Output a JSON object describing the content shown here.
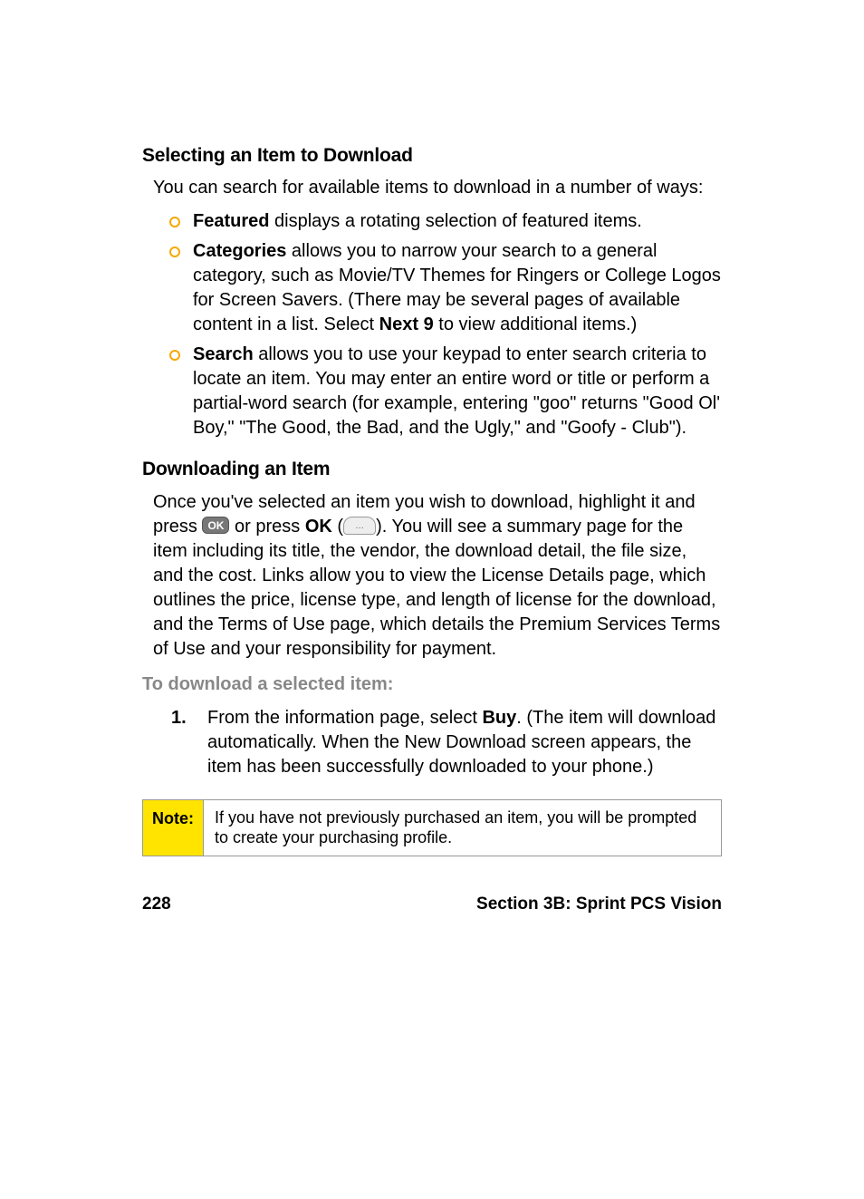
{
  "sections": {
    "selecting": {
      "heading": "Selecting an Item to Download",
      "intro": "You can search for available items to download in a number of ways:",
      "items": [
        {
          "term": "Featured",
          "desc": " displays a rotating selection of featured items."
        },
        {
          "term": "Categories",
          "desc_pre": " allows you to narrow your search to a general category, such as Movie/TV Themes for Ringers or College Logos for Screen Savers. (There may be several pages of available content in a list. Select ",
          "desc_bold": "Next 9",
          "desc_post": " to view additional items.)"
        },
        {
          "term": "Search",
          "desc": " allows you to use your keypad to enter search criteria to locate an item. You may enter an entire word or title or perform a partial-word search (for example, entering \"goo\" returns \"Good Ol' Boy,\" \"The Good, the Bad, and the Ugly,\" and \"Goofy - Club\")."
        }
      ]
    },
    "downloading": {
      "heading": "Downloading an Item",
      "para_pre": "Once you've selected an item you wish to download, highlight it and press ",
      "press_or": " or press ",
      "ok_label": "OK",
      "paren_open": " (",
      "paren_close": "). ",
      "para_post": "You will see a summary page for the item including its title, the vendor, the download detail, the file size, and the cost. Links allow you to view the License Details page, which outlines the price, license type, and length of license for the download, and the Terms of Use page, which details the Premium Services Terms of Use and your responsibility for payment.",
      "subhead": "To download a selected item:",
      "steps": [
        {
          "num": "1.",
          "pre": "From the information page, select ",
          "bold": "Buy",
          "post": ". (The item will download automatically. When the New Download screen appears, the item has been successfully downloaded to your phone.)"
        }
      ]
    },
    "note": {
      "label": "Note:",
      "text": "If you have not previously purchased an item, you will be prompted to create your purchasing profile."
    }
  },
  "icons": {
    "ok_key": "OK",
    "soft_key": "…"
  },
  "footer": {
    "page": "228",
    "section": "Section 3B: Sprint PCS Vision"
  }
}
